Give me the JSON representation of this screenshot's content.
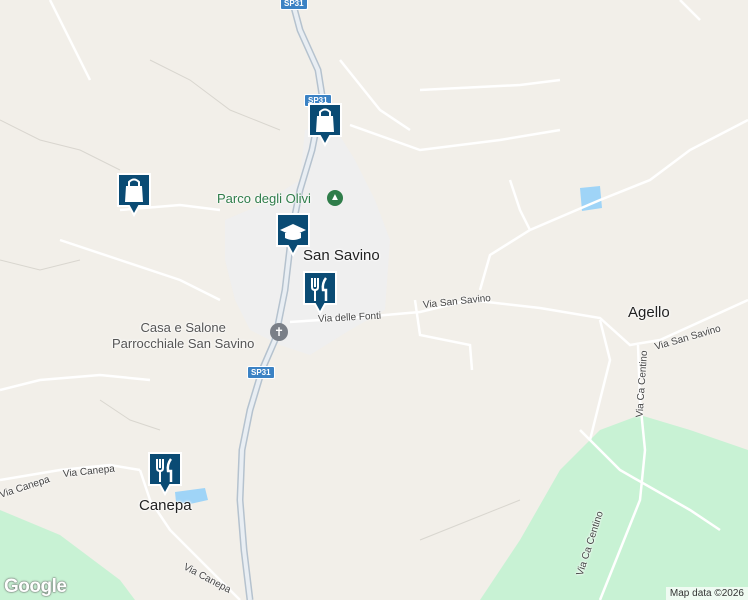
{
  "map": {
    "places": {
      "san_savino": "San Savino",
      "agello": "Agello",
      "canepa": "Canepa"
    },
    "pois": {
      "park": "Parco degli Olivi",
      "church": "Casa e Salone\nParrocchiale San Savino"
    },
    "roads": {
      "sp31_top": "SP31",
      "sp31_mid": "SP31",
      "sp31_bottom": "SP31",
      "via_delle_fonti": "Via delle Fonti",
      "via_san_savino_1": "Via San Savino",
      "via_san_savino_2": "Via San Savino",
      "via_ca_centino_1": "Via Ca Centino",
      "via_ca_centino_2": "Via Ca Centino",
      "via_canepa_1": "Via Canepa",
      "via_canepa_2": "Via Canepa",
      "via_canepa_3": "Via Canepa"
    },
    "markers": [
      {
        "type": "shopping-bag-icon"
      },
      {
        "type": "shopping-bag-icon"
      },
      {
        "type": "school-icon"
      },
      {
        "type": "restaurant-icon"
      },
      {
        "type": "restaurant-icon"
      }
    ],
    "attribution": "Map data ©2026",
    "logo": "Google",
    "colors": {
      "land": "#f2efe9",
      "park": "#c8f0d2",
      "water": "#9fd4f7",
      "marker": "#0a4b74",
      "highway": "#a9b8c6"
    }
  }
}
